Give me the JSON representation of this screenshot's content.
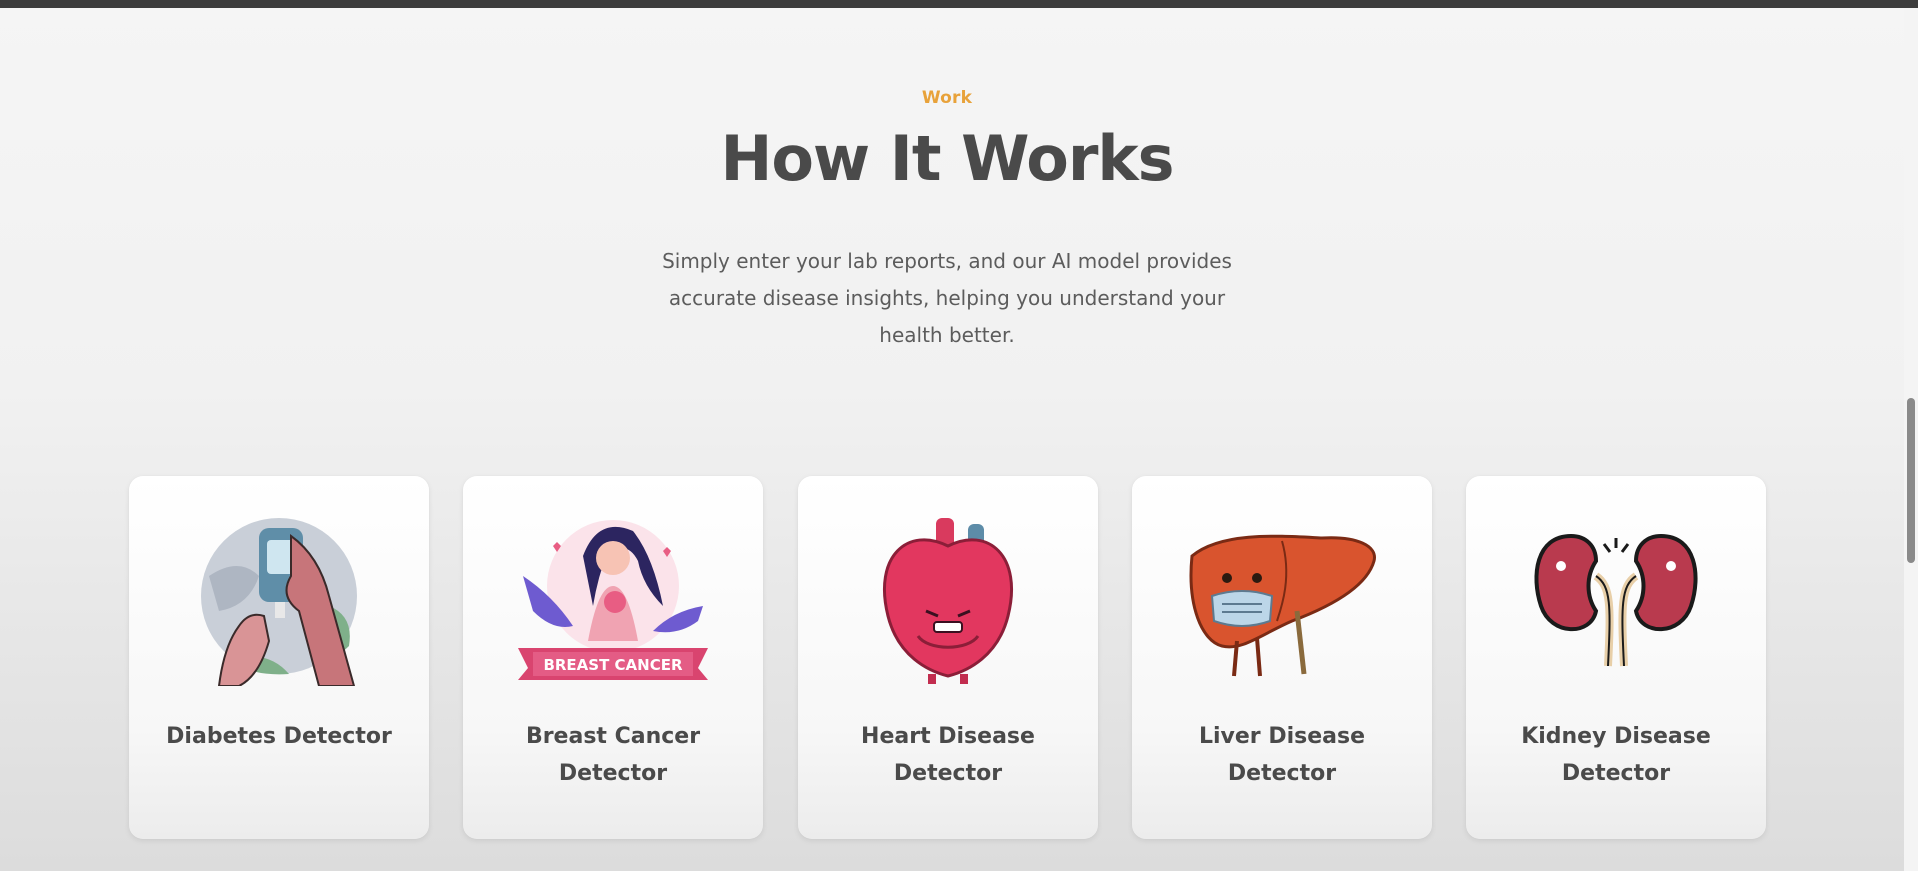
{
  "section": {
    "eyebrow": "Work",
    "title": "How It Works",
    "description": "Simply enter your lab reports, and our AI model provides accurate disease insights, helping you understand your health better."
  },
  "cards": [
    {
      "label": "Diabetes Detector",
      "icon": "glucose-meter-icon"
    },
    {
      "label": "Breast Cancer Detector",
      "icon": "breast-cancer-ribbon-icon"
    },
    {
      "label": "Heart Disease Detector",
      "icon": "heart-icon"
    },
    {
      "label": "Liver Disease Detector",
      "icon": "liver-icon"
    },
    {
      "label": "Kidney Disease Detector",
      "icon": "kidney-icon"
    }
  ],
  "colors": {
    "accent": "#e8a23a",
    "heading": "#4a4a4a",
    "pink": "#d9446f",
    "red": "#d83a3a"
  }
}
